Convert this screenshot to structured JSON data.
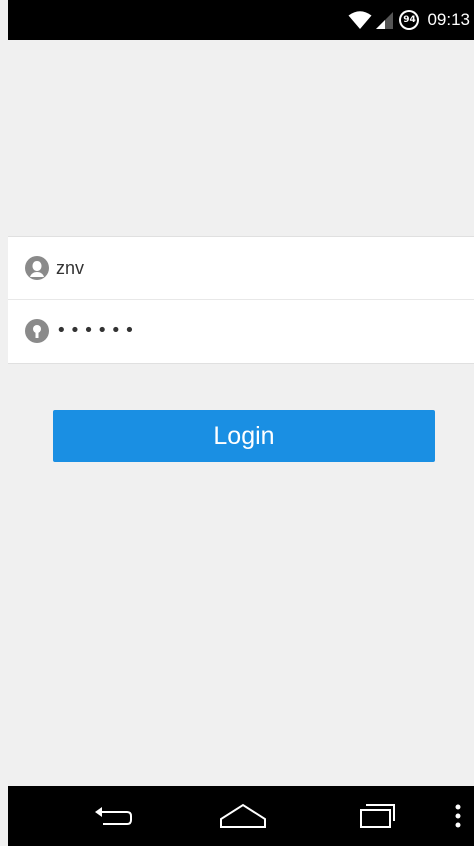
{
  "status_bar": {
    "battery_level": "94",
    "time": "09:13"
  },
  "login_form": {
    "username_value": "znv",
    "password_masked": "••••••"
  },
  "login_button": {
    "label": "Login"
  },
  "colors": {
    "accent": "#1a8fe3",
    "background": "#f0f0f0"
  },
  "icons": {
    "wifi": "wifi-icon",
    "signal": "signal-icon",
    "battery": "battery-icon",
    "user": "user-icon",
    "lock": "lock-icon",
    "back": "back-icon",
    "home": "home-icon",
    "recents": "recents-icon",
    "menu": "menu-icon"
  }
}
